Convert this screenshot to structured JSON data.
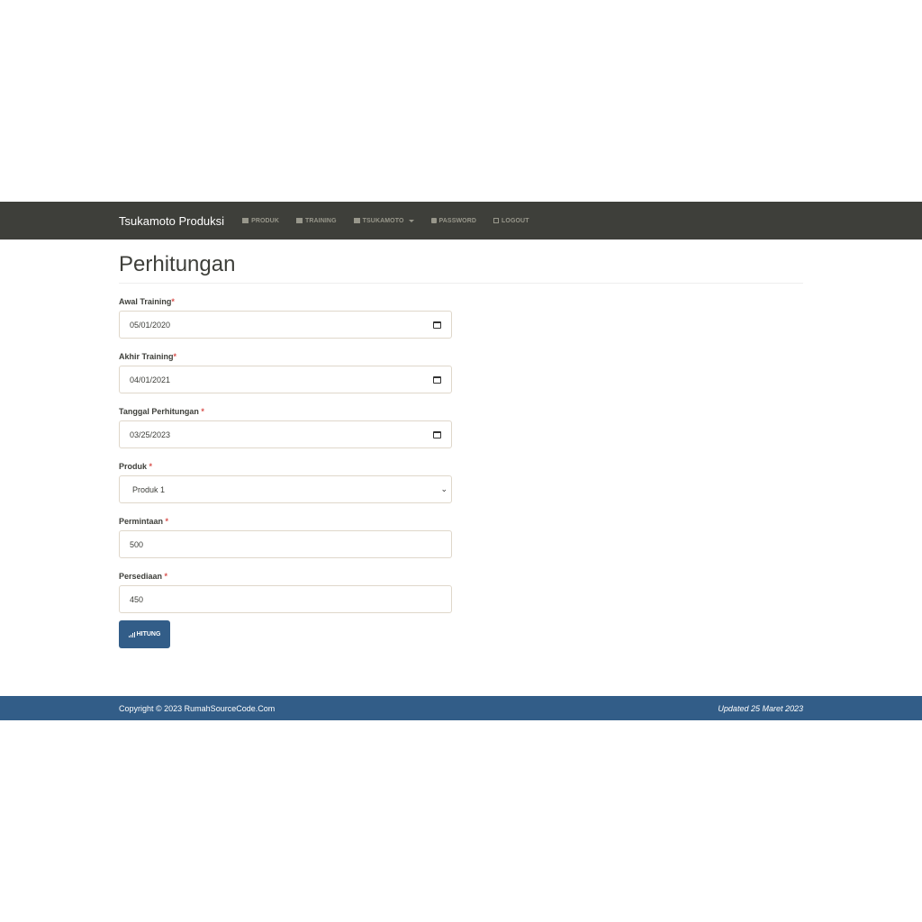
{
  "nav": {
    "brand": "Tsukamoto Produksi",
    "items": [
      {
        "label": "PRODUK",
        "icon": "grid-icon"
      },
      {
        "label": "TRAINING",
        "icon": "table-icon"
      },
      {
        "label": "TSUKAMOTO",
        "icon": "grid-icon"
      },
      {
        "label": "PASSWORD",
        "icon": "lock-icon"
      },
      {
        "label": "LOGOUT",
        "icon": "logout-icon"
      }
    ]
  },
  "page": {
    "title": "Perhitungan"
  },
  "form": {
    "awal": {
      "label": "Awal Training",
      "value": "05/01/2020"
    },
    "akhir": {
      "label": "Akhir Training",
      "value": "04/01/2021"
    },
    "tanggal": {
      "label": "Tanggal Perhitungan ",
      "value": "03/25/2023"
    },
    "produk": {
      "label": "Produk ",
      "value": "Produk 1"
    },
    "permintaan": {
      "label": "Permintaan ",
      "value": "500"
    },
    "persediaan": {
      "label": "Persediaan ",
      "value": "450"
    },
    "required_mark": "*",
    "submit": "HITUNG"
  },
  "footer": {
    "copyright": "Copyright © 2023 RumahSourceCode.Com",
    "updated": "Updated 25 Maret 2023"
  }
}
